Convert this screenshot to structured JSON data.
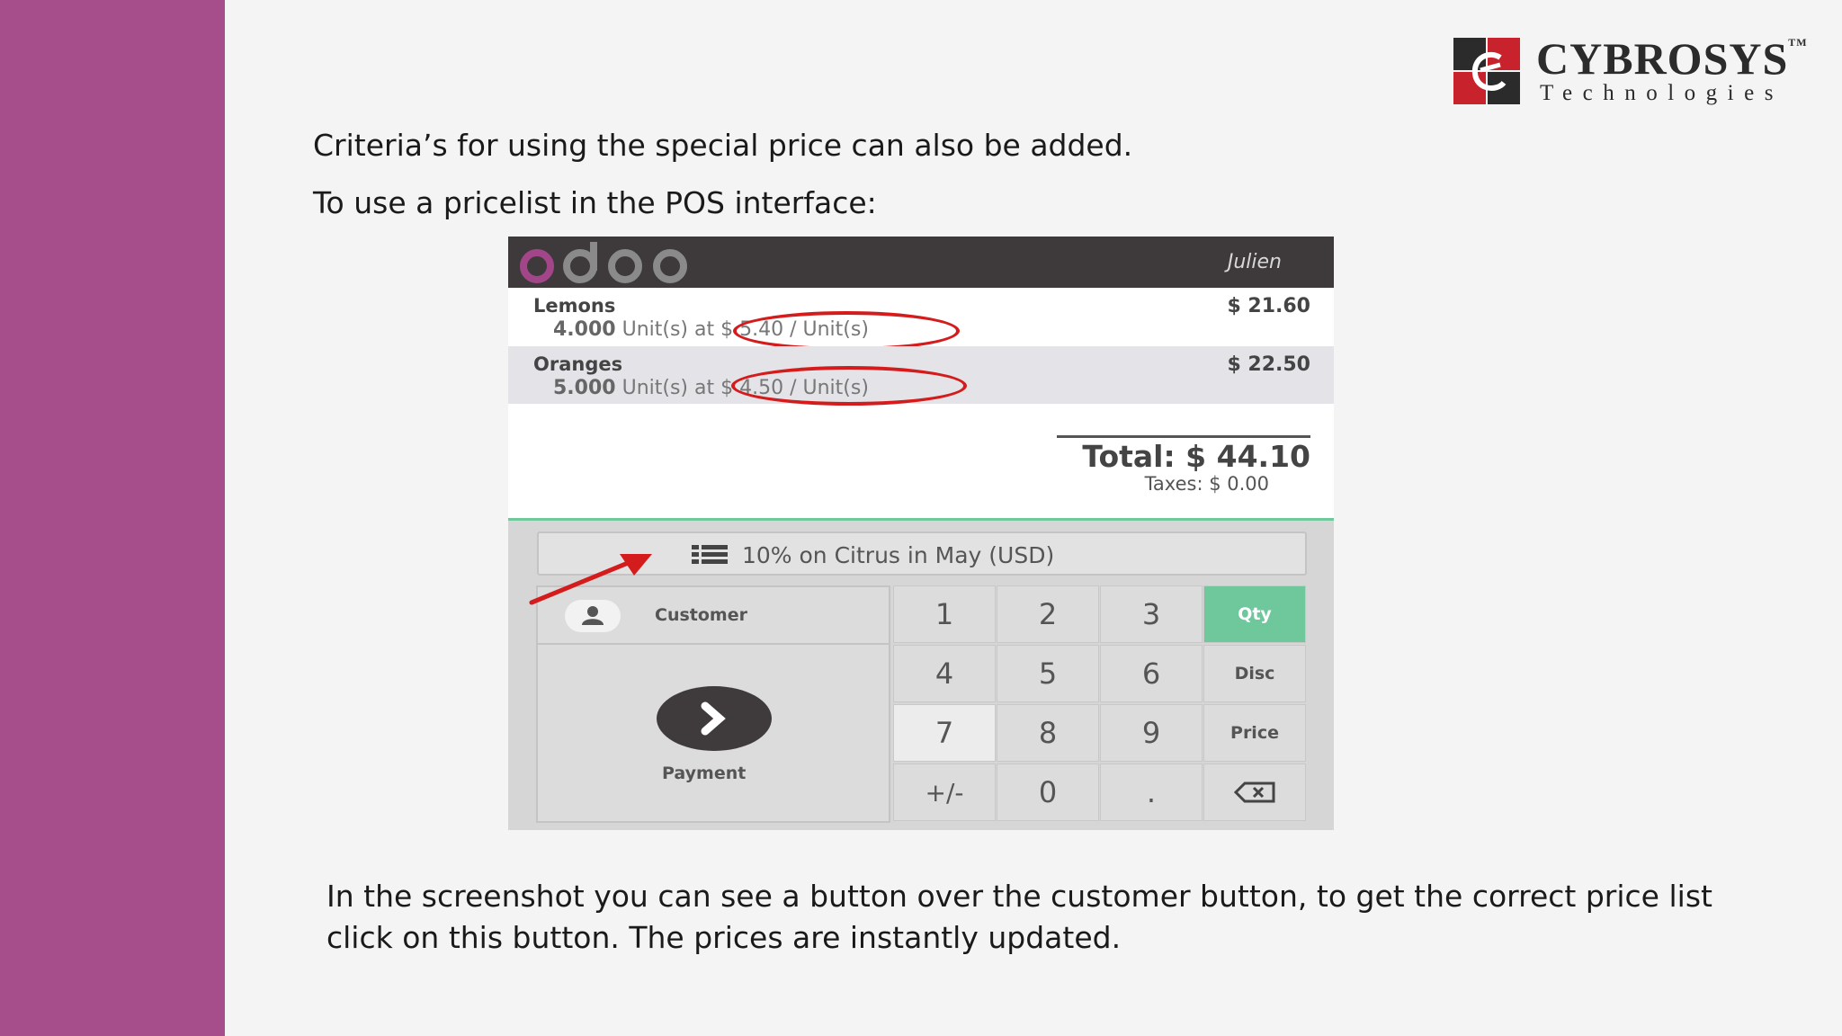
{
  "brand": {
    "name": "CYBROSYS",
    "trademark": "TM",
    "tagline": "Technologies"
  },
  "slide": {
    "line1": "Criteria’s for using the special price can also be added.",
    "line2": "To use a pricelist in the POS interface:",
    "description": "In the screenshot you can see a button over the customer button, to get the correct price list click on this button. The prices are instantly updated."
  },
  "pos": {
    "user": "Julien",
    "orderlines": [
      {
        "name": "Lemons",
        "qty": "4.000",
        "unit": "Unit(s)",
        "at": "at",
        "unit_price": "$ 5.40 / Unit(s)",
        "price": "$ 21.60"
      },
      {
        "name": "Oranges",
        "qty": "5.000",
        "unit": "Unit(s)",
        "at": "at",
        "unit_price": "$ 4.50 / Unit(s)",
        "price": "$ 22.50"
      }
    ],
    "total": "Total: $ 44.10",
    "taxes": "Taxes: $ 0.00",
    "pricelist": "10% on Citrus in May (USD)",
    "customer": "Customer",
    "payment": "Payment",
    "keys": {
      "k1": "1",
      "k2": "2",
      "k3": "3",
      "qty": "Qty",
      "k4": "4",
      "k5": "5",
      "k6": "6",
      "disc": "Disc",
      "k7": "7",
      "k8": "8",
      "k9": "9",
      "price": "Price",
      "plusminus": "+/-",
      "k0": "0",
      "dot": "."
    }
  },
  "colors": {
    "sidebar": "#a64d8c",
    "accent_green": "#6ec89b",
    "annotation_red": "#d41c1c",
    "odoo_purple": "#a24689"
  }
}
